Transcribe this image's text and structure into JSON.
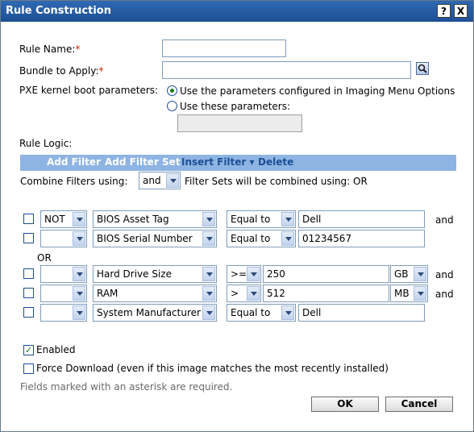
{
  "dialog": {
    "title": "Rule Construction",
    "help_label": "?",
    "close_label": "X"
  },
  "form": {
    "rule_name_label": "Rule Name:",
    "rule_name_value": "",
    "bundle_label": "Bundle to Apply:",
    "bundle_value": "",
    "required_mark": "*",
    "pxe_label": "PXE kernel boot parameters:",
    "pxe_option1": "Use the parameters configured in Imaging Menu Options",
    "pxe_option2": "Use these parameters:",
    "pxe_params_value": ""
  },
  "logic": {
    "label": "Rule Logic:",
    "toolbar": {
      "add_filter": "Add Filter",
      "add_filter_set": "Add Filter Set",
      "insert_filter": "Insert Filter ▾",
      "delete": "Delete"
    },
    "combine_label": "Combine Filters using:",
    "combine_value": "and",
    "sets_text": "Filter Sets will be combined using: OR",
    "or_label": "OR",
    "rows": [
      {
        "not": "NOT",
        "field": "BIOS Asset Tag",
        "op": "Equal to",
        "value": "Dell",
        "unit": "",
        "conj": "and"
      },
      {
        "not": "",
        "field": "BIOS Serial Number",
        "op": "Equal to",
        "value": "01234567",
        "unit": "",
        "conj": ""
      },
      {
        "not": "",
        "field": "Hard Drive Size",
        "op": ">=",
        "value": "250",
        "unit": "GB",
        "conj": "and"
      },
      {
        "not": "",
        "field": "RAM",
        "op": ">",
        "value": "512",
        "unit": "MB",
        "conj": "and"
      },
      {
        "not": "",
        "field": "System Manufacturer",
        "op": "Equal to",
        "value": "Dell",
        "unit": "",
        "conj": ""
      }
    ]
  },
  "options": {
    "enabled_label": "Enabled",
    "force_label": "Force Download (even if this image matches the most recently installed)",
    "required_note": "Fields marked with an asterisk are required."
  },
  "buttons": {
    "ok": "OK",
    "cancel": "Cancel"
  }
}
